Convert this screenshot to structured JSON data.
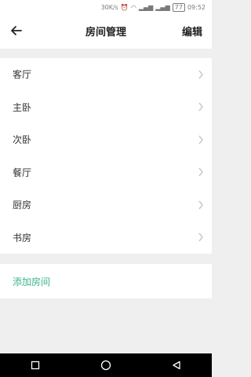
{
  "status_bar": {
    "speed": "30K/s",
    "time": "09:52",
    "battery": "77"
  },
  "nav": {
    "title": "房间管理",
    "edit_label": "编辑",
    "back_icon": "arrow-left-icon"
  },
  "rooms": [
    {
      "label": "客厅"
    },
    {
      "label": "主卧"
    },
    {
      "label": "次卧"
    },
    {
      "label": "餐厅"
    },
    {
      "label": "厨房"
    },
    {
      "label": "书房"
    }
  ],
  "add_room": {
    "label": "添加房间"
  },
  "colors": {
    "accent": "#38b78a",
    "background": "#efefef"
  }
}
